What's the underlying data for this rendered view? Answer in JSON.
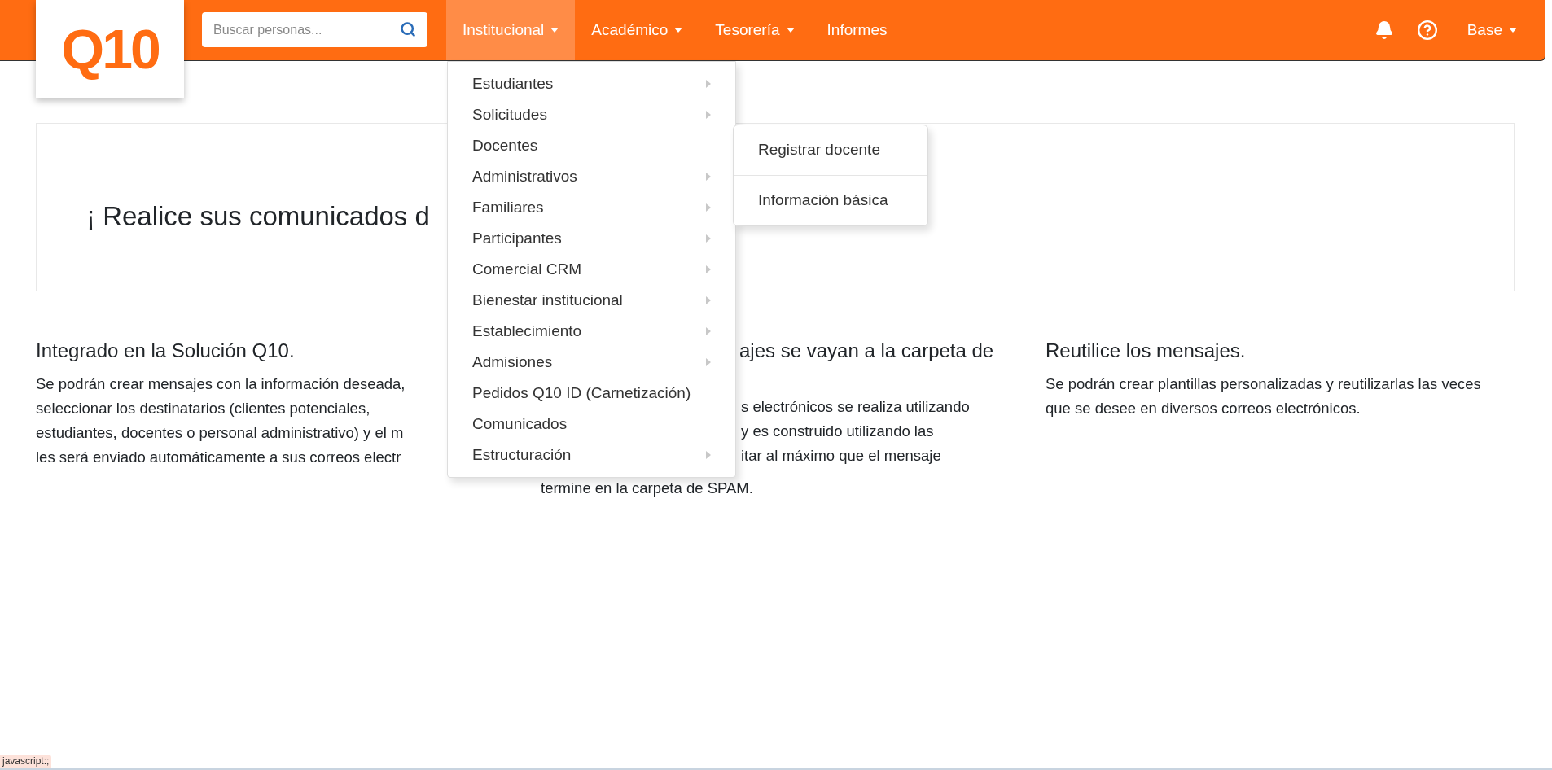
{
  "header": {
    "logo": "Q10",
    "search": {
      "placeholder": "Buscar personas..."
    },
    "nav": [
      {
        "label": "Institucional",
        "selected": true,
        "caret": true
      },
      {
        "label": "Académico",
        "selected": false,
        "caret": true
      },
      {
        "label": "Tesorería",
        "selected": false,
        "caret": true
      },
      {
        "label": "Informes",
        "selected": false,
        "caret": false
      }
    ],
    "user": {
      "label": "Base"
    }
  },
  "menu": {
    "items": [
      {
        "label": "Estudiantes",
        "submenu": true
      },
      {
        "label": "Solicitudes",
        "submenu": true
      },
      {
        "label": "Docentes",
        "submenu": false
      },
      {
        "label": "Administrativos",
        "submenu": true
      },
      {
        "label": "Familiares",
        "submenu": true
      },
      {
        "label": "Participantes",
        "submenu": true
      },
      {
        "label": "Comercial CRM",
        "submenu": true
      },
      {
        "label": "Bienestar institucional",
        "submenu": true
      },
      {
        "label": "Establecimiento",
        "submenu": true
      },
      {
        "label": "Admisiones",
        "submenu": true
      },
      {
        "label": "Pedidos Q10 ID (Carnetización)",
        "submenu": false
      },
      {
        "label": "Comunicados",
        "submenu": false
      },
      {
        "label": "Estructuración",
        "submenu": true
      }
    ],
    "submenu": [
      "Registrar docente",
      "Información básica"
    ]
  },
  "hero": {
    "title": "¡ Realice sus comunicados d"
  },
  "features": [
    {
      "heading": "Integrado en la Solución Q10.",
      "lines": [
        "Se podrán crear mensajes con la información deseada,",
        "seleccionar los destinatarios (clientes potenciales,",
        "estudiantes, docentes o personal administrativo) y el m",
        "les será enviado automáticamente a sus correos electr"
      ]
    },
    {
      "heading": "ajes se vayan a la carpeta de",
      "lines": [
        "s electrónicos se realiza utilizando",
        "y es construido utilizando las",
        "itar al máximo que el mensaje"
      ],
      "tail": "termine en la carpeta de SPAM.",
      "covered": true
    },
    {
      "heading": "Reutilice los mensajes.",
      "lines": [
        "Se podrán crear plantillas personalizadas y reutilizarlas las veces que se desee en diversos correos electrónicos."
      ]
    }
  ],
  "status_bar": {
    "url": "javascript:;"
  }
}
